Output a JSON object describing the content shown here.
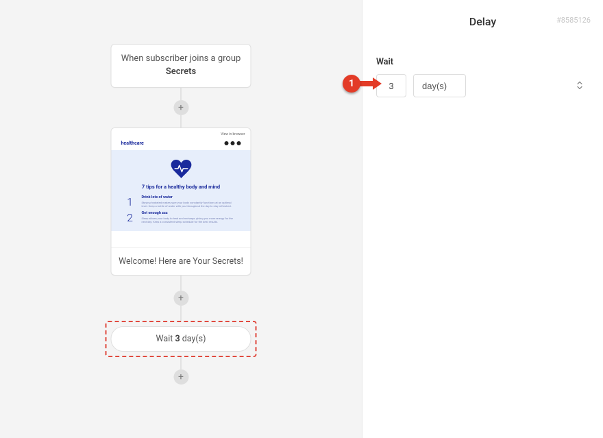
{
  "flow": {
    "trigger": {
      "line1": "When subscriber joins a group",
      "group": "Secrets"
    },
    "email": {
      "brand": "healthcare",
      "view_label": "View in browser",
      "hero_title": "7 tips for a healthy body and mind",
      "tips": [
        {
          "num": "1",
          "h": "Drink lots of water",
          "p": "Staying hydrated makes sure your body constantly functions at an optimal level. Keep a bottle of water with you throughout the day to stay refreshed."
        },
        {
          "num": "2",
          "h": "Get enough zzz",
          "p": "Sleep allows your body to heal and recharge, giving you more energy for the next day. Keep a consistent sleep schedule for the best results."
        }
      ],
      "caption": "Welcome! Here are Your Secrets!"
    },
    "delay": {
      "prefix": "Wait",
      "value": "3",
      "unit": "day(s)"
    }
  },
  "sidebar": {
    "title": "Delay",
    "id": "#8585126",
    "field_label": "Wait",
    "value": "3",
    "unit_selected": "day(s)"
  },
  "annotation": {
    "number": "1"
  }
}
